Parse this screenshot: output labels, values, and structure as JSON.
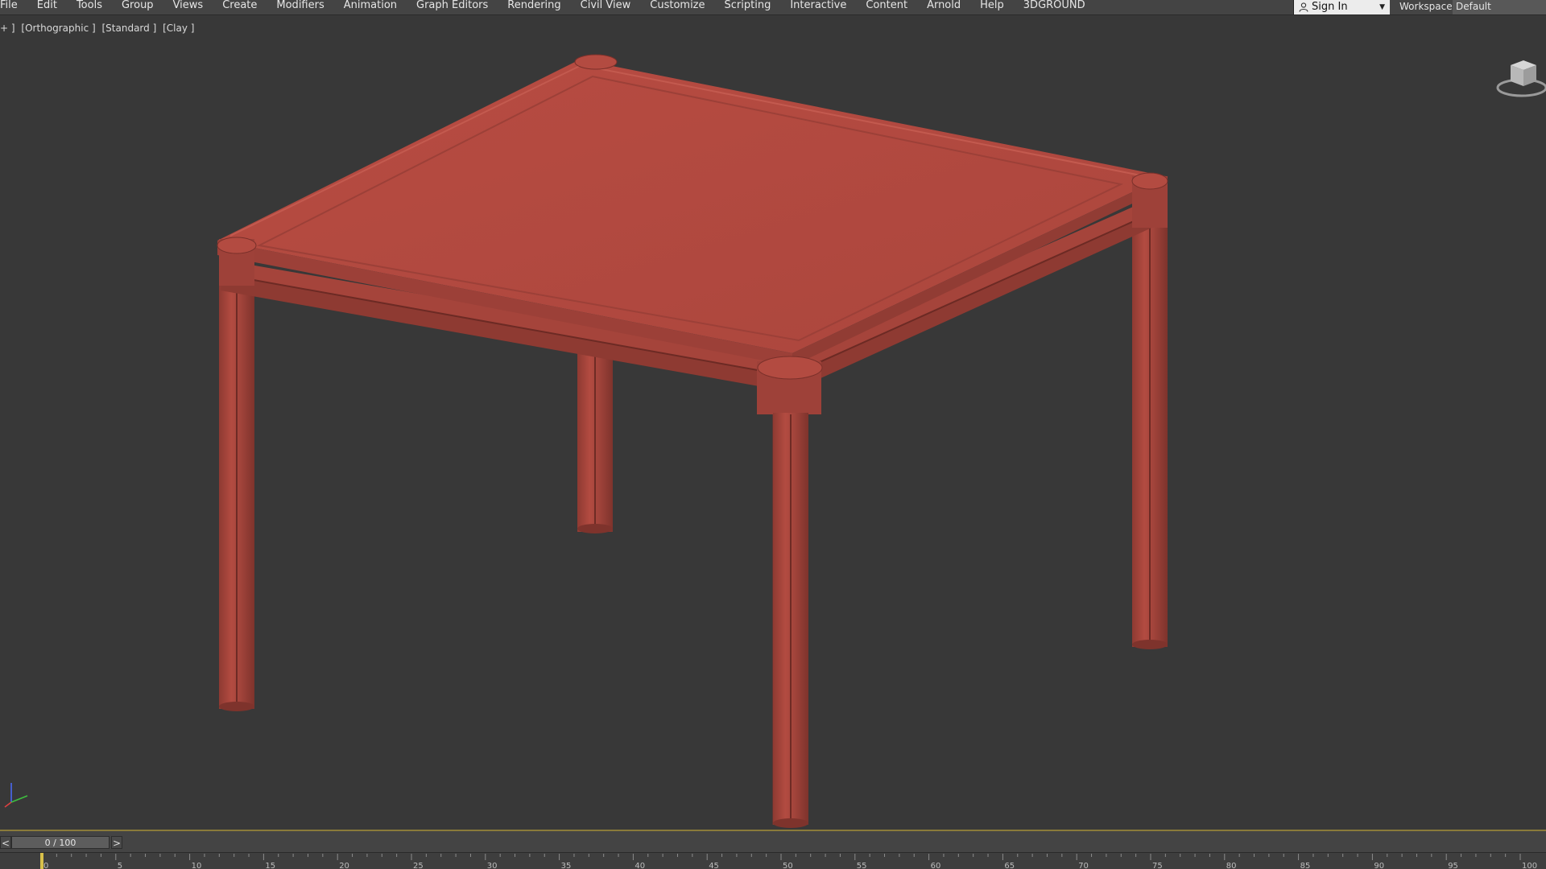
{
  "menubar": {
    "items": [
      "File",
      "Edit",
      "Tools",
      "Group",
      "Views",
      "Create",
      "Modifiers",
      "Animation",
      "Graph Editors",
      "Rendering",
      "Civil View",
      "Customize",
      "Scripting",
      "Interactive",
      "Content",
      "Arnold",
      "Help",
      "3DGROUND"
    ]
  },
  "account": {
    "signin_label": "Sign In",
    "workspaces_label": "Workspaces:",
    "workspace_value": "Default"
  },
  "viewport": {
    "labels": [
      "+ ]",
      "[Orthographic ]",
      "[Standard ]",
      "[Clay ]"
    ],
    "object_color": "#b34b41",
    "background_color": "#383838"
  },
  "timeslider": {
    "prev_label": "<",
    "next_label": ">",
    "frame_readout": "0 / 100",
    "current_frame": 0,
    "total_frames": 100
  },
  "trackbar": {
    "tick_labels": [
      "0",
      "5",
      "10",
      "15",
      "20",
      "25",
      "30",
      "35",
      "40",
      "45",
      "50",
      "55",
      "60",
      "65",
      "70",
      "75",
      "80",
      "85",
      "90",
      "95",
      "100"
    ]
  }
}
